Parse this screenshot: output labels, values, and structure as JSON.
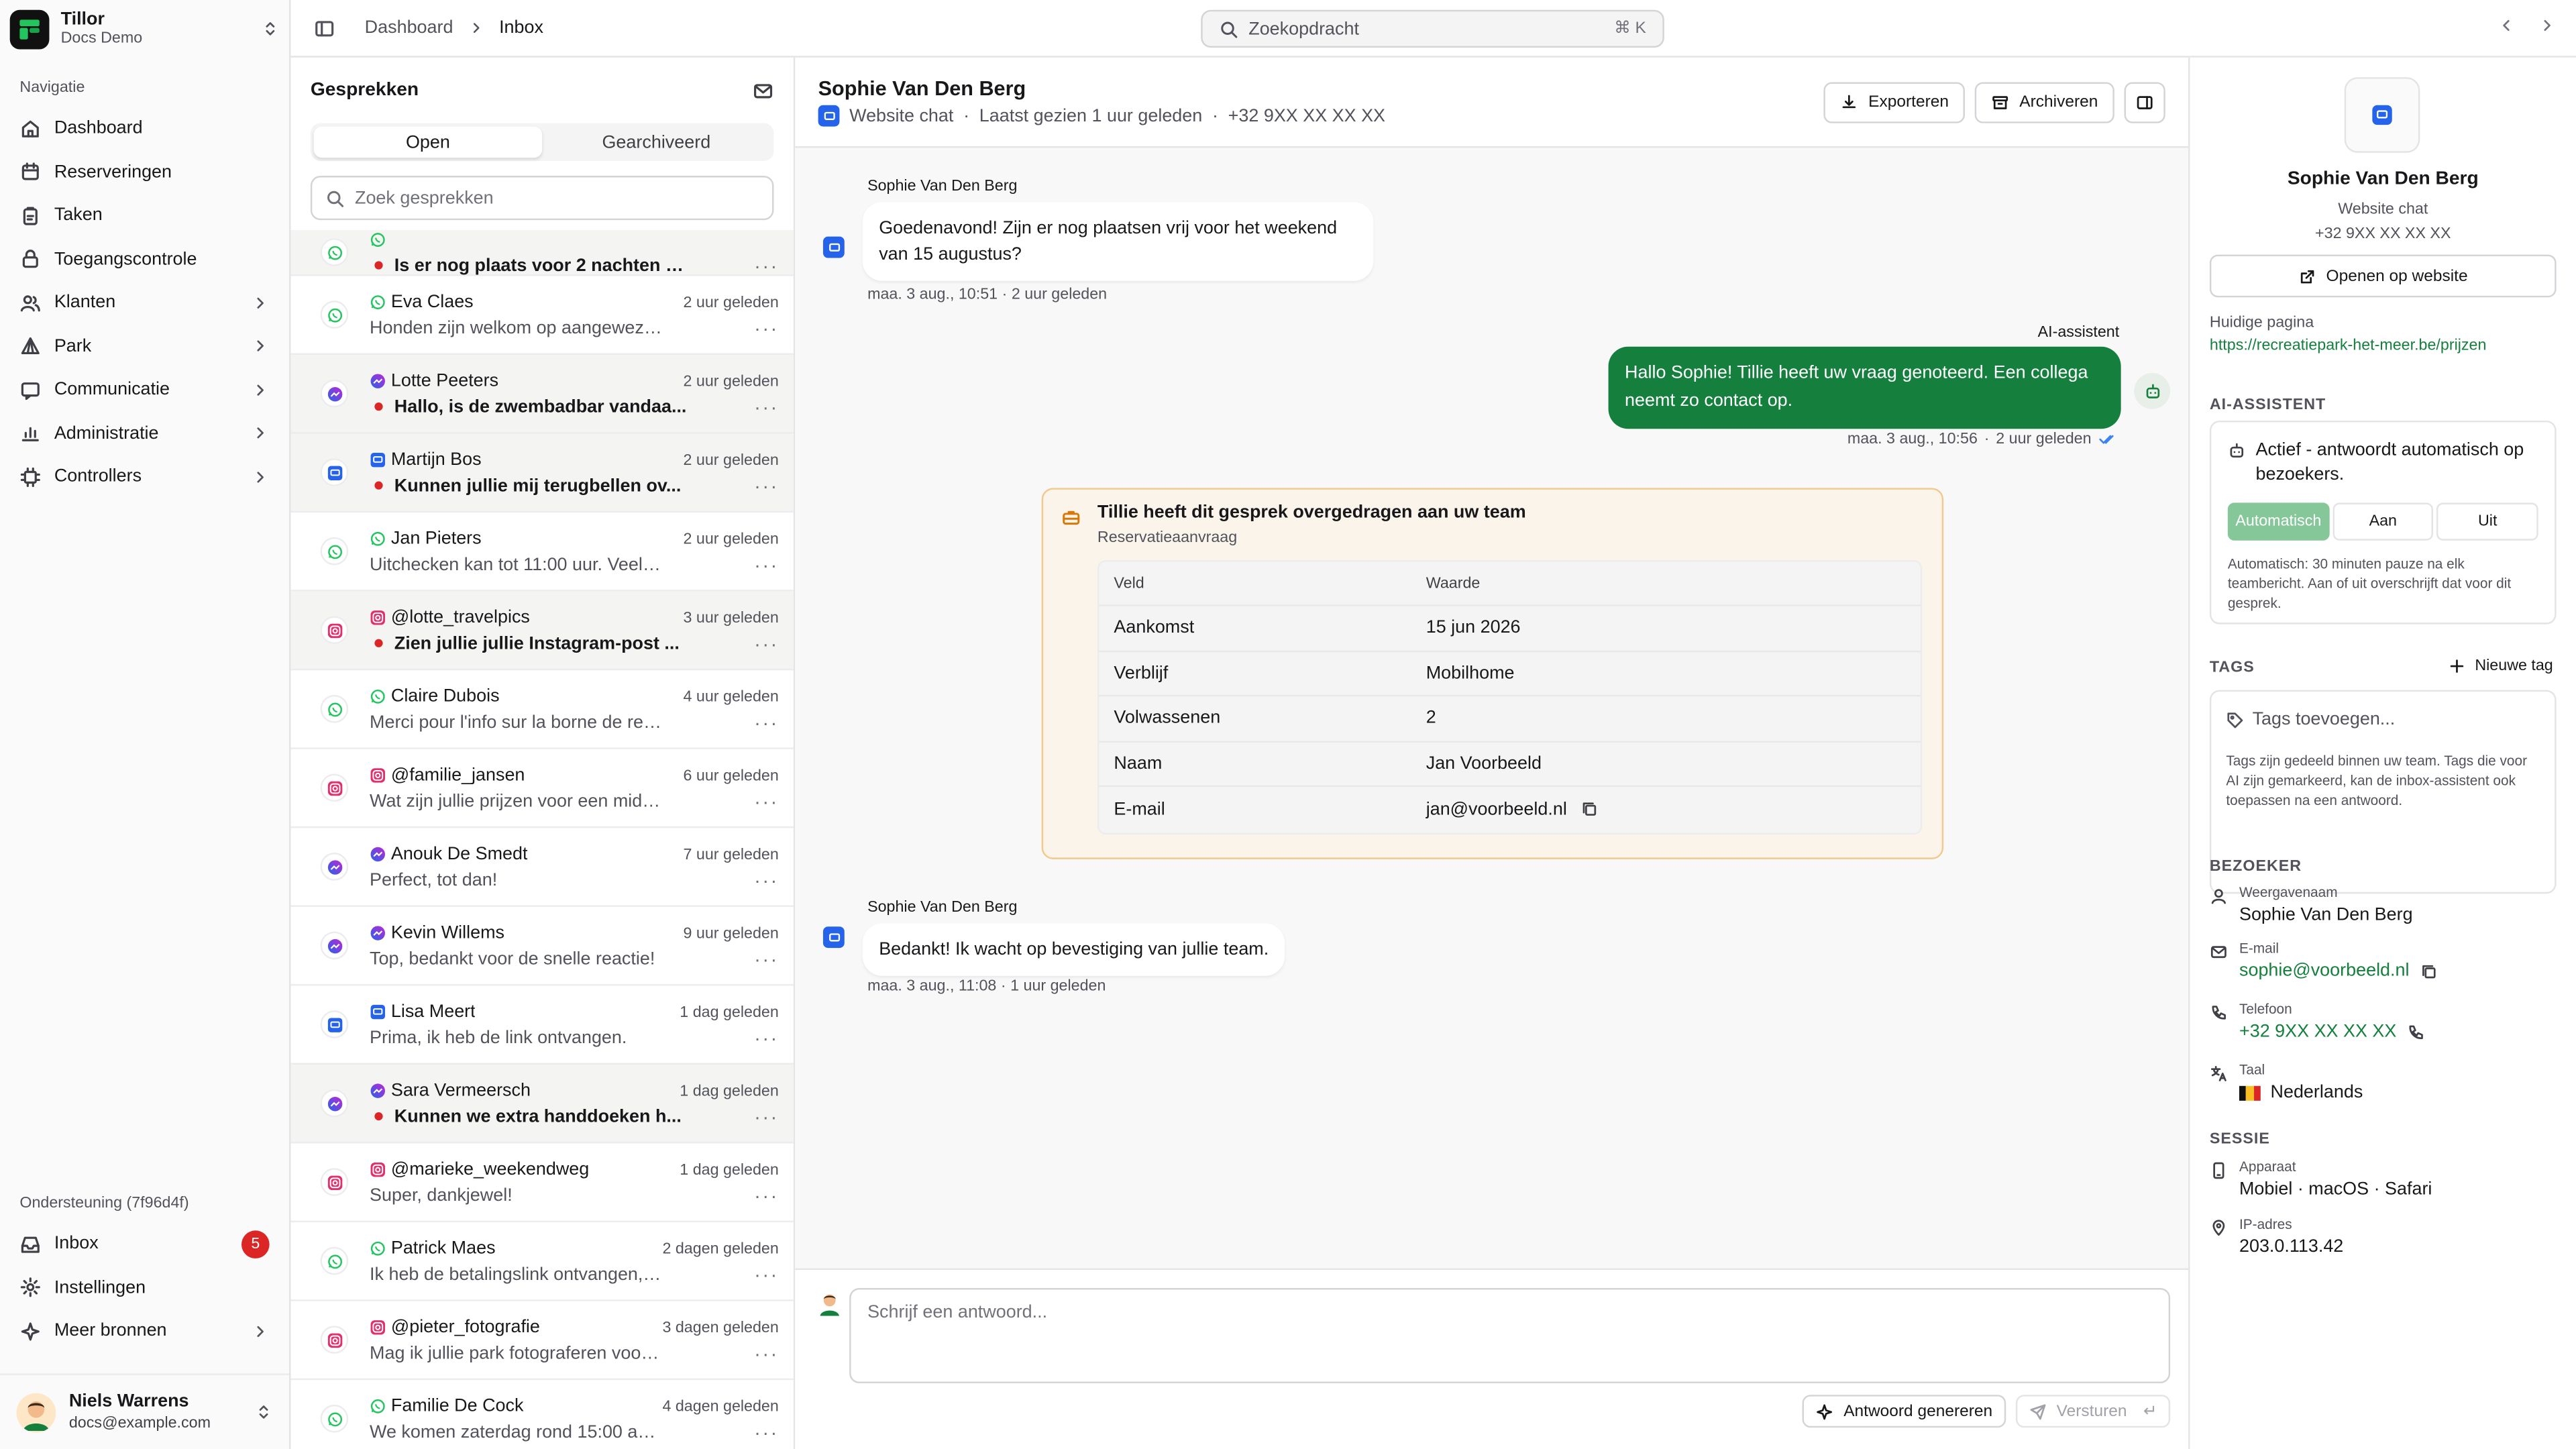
{
  "brand": {
    "name": "Tillor",
    "sub": "Docs Demo"
  },
  "nav": {
    "section_label": "Navigatie",
    "items": [
      {
        "label": "Dashboard",
        "icon": "home-icon",
        "has_children": false
      },
      {
        "label": "Reserveringen",
        "icon": "calendar-icon",
        "has_children": false
      },
      {
        "label": "Taken",
        "icon": "clipboard-icon",
        "has_children": false
      },
      {
        "label": "Toegangscontrole",
        "icon": "lock-icon",
        "has_children": false
      },
      {
        "label": "Klanten",
        "icon": "users-icon",
        "has_children": true
      },
      {
        "label": "Park",
        "icon": "tent-icon",
        "has_children": true
      },
      {
        "label": "Communicatie",
        "icon": "message-icon",
        "has_children": true
      },
      {
        "label": "Administratie",
        "icon": "chart-icon",
        "has_children": true
      },
      {
        "label": "Controllers",
        "icon": "chip-icon",
        "has_children": true
      }
    ]
  },
  "support": {
    "label": "Ondersteuning (7f96d4f)",
    "items": [
      {
        "label": "Inbox",
        "icon": "inbox-icon",
        "badge": "5"
      },
      {
        "label": "Instellingen",
        "icon": "gear-icon",
        "badge": ""
      },
      {
        "label": "Meer bronnen",
        "icon": "sparkle-icon",
        "badge": ""
      }
    ]
  },
  "user": {
    "name": "Niels Warrens",
    "email": "docs@example.com"
  },
  "topbar": {
    "breadcrumb": [
      "Dashboard",
      "Inbox"
    ],
    "search_placeholder": "Zoekopdracht",
    "search_shortcut": "⌘ K"
  },
  "conversations": {
    "title": "Gesprekken",
    "tabs": [
      "Open",
      "Gearchiveerd"
    ],
    "active_tab": "Open",
    "search_placeholder": "Zoek gesprekken",
    "items": [
      {
        "channel": "whatsapp",
        "name": "",
        "preview": "Is er nog plaats voor 2 nachten v...",
        "time": "",
        "unread": true
      },
      {
        "channel": "whatsapp",
        "name": "Eva Claes",
        "preview": "Honden zijn welkom op aangewezen ...",
        "time": "2 uur geleden",
        "unread": false
      },
      {
        "channel": "messenger",
        "name": "Lotte Peeters",
        "preview": "Hallo, is de zwembadbar vandaa...",
        "time": "2 uur geleden",
        "unread": true
      },
      {
        "channel": "webchat",
        "name": "Martijn Bos",
        "preview": "Kunnen jullie mij terugbellen ov...",
        "time": "2 uur geleden",
        "unread": true
      },
      {
        "channel": "whatsapp",
        "name": "Jan Pieters",
        "preview": "Uitchecken kan tot 11:00 uur. Veel ple...",
        "time": "2 uur geleden",
        "unread": false
      },
      {
        "channel": "instagram",
        "name": "@lotte_travelpics",
        "preview": "Zien jullie jullie Instagram-post ...",
        "time": "3 uur geleden",
        "unread": true
      },
      {
        "channel": "whatsapp",
        "name": "Claire Dubois",
        "preview": "Merci pour l'info sur la borne de rechar...",
        "time": "4 uur geleden",
        "unread": false
      },
      {
        "channel": "instagram",
        "name": "@familie_jansen",
        "preview": "Wat zijn jullie prijzen voor een midwee...",
        "time": "6 uur geleden",
        "unread": false
      },
      {
        "channel": "messenger",
        "name": "Anouk De Smedt",
        "preview": "Perfect, tot dan!",
        "time": "7 uur geleden",
        "unread": false
      },
      {
        "channel": "messenger",
        "name": "Kevin Willems",
        "preview": "Top, bedankt voor de snelle reactie!",
        "time": "9 uur geleden",
        "unread": false
      },
      {
        "channel": "webchat",
        "name": "Lisa Meert",
        "preview": "Prima, ik heb de link ontvangen.",
        "time": "1 dag geleden",
        "unread": false
      },
      {
        "channel": "messenger",
        "name": "Sara Vermeersch",
        "preview": "Kunnen we extra handdoeken h...",
        "time": "1 dag geleden",
        "unread": true
      },
      {
        "channel": "instagram",
        "name": "@marieke_weekendweg",
        "preview": "Super, dankjewel!",
        "time": "1 dag geleden",
        "unread": false
      },
      {
        "channel": "whatsapp",
        "name": "Patrick Maes",
        "preview": "Ik heb de betalingslink ontvangen, ...",
        "time": "2 dagen geleden",
        "unread": false
      },
      {
        "channel": "instagram",
        "name": "@pieter_fotografie",
        "preview": "Mag ik jullie park fotograferen voor ...",
        "time": "3 dagen geleden",
        "unread": false
      },
      {
        "channel": "whatsapp",
        "name": "Familie De Cock",
        "preview": "We komen zaterdag rond 15:00 aan.",
        "time": "4 dagen geleden",
        "unread": false
      }
    ]
  },
  "chat": {
    "name": "Sophie Van Den Berg",
    "channel": "Website chat",
    "last_seen": "Laatst gezien 1 uur geleden",
    "phone": "+32 9XX XX XX XX",
    "export_label": "Exporteren",
    "archive_label": "Archiveren",
    "messages": {
      "m1": {
        "author": "Sophie Van Den Berg",
        "text": "Goedenavond! Zijn er nog plaatsen vrij voor het weekend van 15 augustus?",
        "date": "maa. 3 aug., 10:51",
        "ago": "2 uur geleden"
      },
      "m2": {
        "author": "AI-assistent",
        "text": "Hallo Sophie! Tillie heeft uw vraag genoteerd. Een collega neemt zo contact op.",
        "date": "maa. 3 aug., 10:56",
        "ago": "2 uur geleden"
      },
      "m3": {
        "author": "Sophie Van Den Berg",
        "text": "Bedankt! Ik wacht op bevestiging van jullie team.",
        "date": "maa. 3 aug., 11:08",
        "ago": "1 uur geleden"
      }
    },
    "handoff": {
      "title": "Tillie heeft dit gesprek overgedragen aan uw team",
      "subtitle": "Reservatieaanvraag",
      "head_field": "Veld",
      "head_value": "Waarde",
      "rows": [
        {
          "field": "Aankomst",
          "value": "15 jun 2026"
        },
        {
          "field": "Verblijf",
          "value": "Mobilhome"
        },
        {
          "field": "Volwassenen",
          "value": "2"
        },
        {
          "field": "Naam",
          "value": "Jan Voorbeeld"
        },
        {
          "field": "E-mail",
          "value": "jan@voorbeeld.nl"
        }
      ]
    },
    "composer": {
      "placeholder": "Schrijf een antwoord...",
      "generate_label": "Antwoord genereren",
      "send_label": "Versturen"
    }
  },
  "visitor_panel": {
    "name": "Sophie Van Den Berg",
    "channel": "Website chat",
    "phone": "+32 9XX XX XX XX",
    "open_site_label": "Openen op website",
    "current_page_label": "Huidige pagina",
    "current_page_url": "https://recreatiepark-het-meer.be/prijzen",
    "ai_heading": "AI-ASSISTENT",
    "ai_status": "Actief - antwoordt automatisch op bezoekers.",
    "ai_options": [
      "Automatisch",
      "Aan",
      "Uit"
    ],
    "ai_selected": "Automatisch",
    "ai_note": "Automatisch: 30 minuten pauze na elk teambericht. Aan of uit overschrijft dat voor dit gesprek.",
    "tags_heading": "TAGS",
    "new_tag_label": "Nieuwe tag",
    "tags_placeholder": "Tags toevoegen...",
    "tags_note": "Tags zijn gedeeld binnen uw team. Tags die voor AI zijn gemarkeerd, kan de inbox-assistent ook toepassen na een antwoord.",
    "visitor_heading": "BEZOEKER",
    "display_name_label": "Weergavenaam",
    "display_name": "Sophie Van Den Berg",
    "email_label": "E-mail",
    "email": "sophie@voorbeeld.nl",
    "phone_label": "Telefoon",
    "language_label": "Taal",
    "language": "Nederlands",
    "session_heading": "SESSIE",
    "device_label": "Apparaat",
    "device": "Mobiel · macOS · Safari",
    "ip_label": "IP-adres",
    "ip": "203.0.113.42"
  },
  "colors": {
    "accent_green": "#15803d",
    "unread_dot": "#dc2626",
    "webchat_blue": "#2563eb",
    "handoff_bg": "#fbf4ea",
    "handoff_border": "#f2c98c"
  }
}
